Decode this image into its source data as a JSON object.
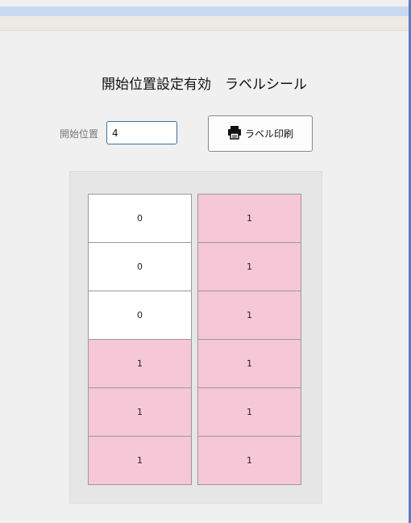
{
  "header": {
    "title": "開始位置設定有効　ラベルシール"
  },
  "form": {
    "start_label": "開始位置",
    "start_value": "4",
    "print_button_label": "ラベル印刷",
    "print_icon": "printer-icon"
  },
  "grid": {
    "columns": [
      [
        "0",
        "0",
        "0",
        "1",
        "1",
        "1"
      ],
      [
        "1",
        "1",
        "1",
        "1",
        "1",
        "1"
      ]
    ],
    "colors": {
      "off": "#ffffff",
      "on": "#f6c7d7"
    }
  }
}
